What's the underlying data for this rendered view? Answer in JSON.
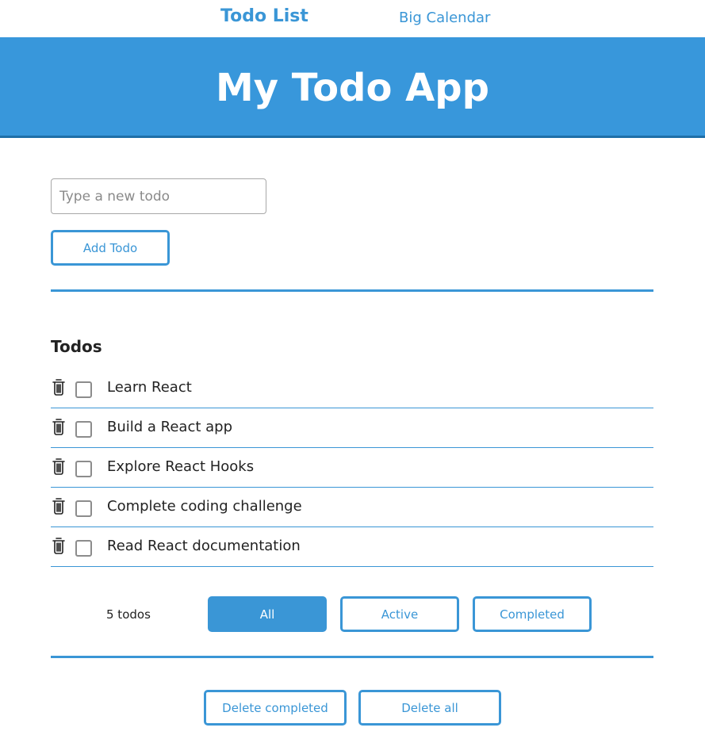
{
  "nav": {
    "items": [
      {
        "label": "Todo List"
      },
      {
        "label": "Big Calendar"
      }
    ]
  },
  "header": {
    "title": "My Todo App"
  },
  "form": {
    "input_placeholder": "Type a new todo",
    "input_value": "",
    "add_label": "Add Todo"
  },
  "list": {
    "title": "Todos",
    "items": [
      {
        "text": "Learn React",
        "completed": false,
        "icon": "trash-icon"
      },
      {
        "text": "Build a React app",
        "completed": false,
        "icon": "trash-icon"
      },
      {
        "text": "Explore React Hooks",
        "completed": false,
        "icon": "trash-icon"
      },
      {
        "text": "Complete coding challenge",
        "completed": false,
        "icon": "trash-icon"
      },
      {
        "text": "Read React documentation",
        "completed": false,
        "icon": "trash-icon"
      }
    ]
  },
  "footer": {
    "count_label": "5 todos",
    "filters": [
      {
        "label": "All",
        "selected": true
      },
      {
        "label": "Active",
        "selected": false
      },
      {
        "label": "Completed",
        "selected": false
      }
    ]
  },
  "actions": {
    "delete_completed_label": "Delete completed",
    "delete_all_label": "Delete all"
  },
  "colors": {
    "accent": "#3a96d6",
    "banner": "#3897db",
    "banner_border": "#1f6fa8"
  }
}
